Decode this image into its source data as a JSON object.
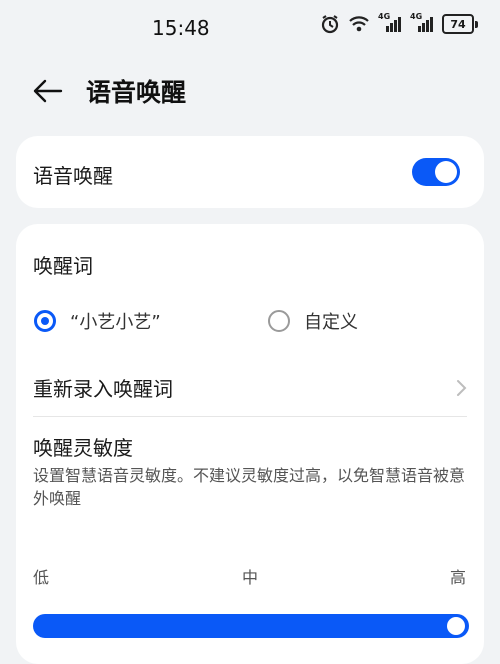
{
  "status_bar": {
    "time": "15:48",
    "signal1_label": "4G",
    "signal2_label": "4G",
    "battery": "74"
  },
  "header": {
    "title": "语音唤醒"
  },
  "voice_wakeup": {
    "label": "语音唤醒",
    "enabled": true
  },
  "wake_word": {
    "title": "唤醒词",
    "options": [
      {
        "label": "“小艺小艺”",
        "selected": true
      },
      {
        "label": "自定义",
        "selected": false
      }
    ],
    "rerecord_label": "重新录入唤醒词"
  },
  "sensitivity": {
    "title": "唤醒灵敏度",
    "description": "设置智慧语音灵敏度。不建议灵敏度过高，以免智慧语音被意外唤醒",
    "low": "低",
    "mid": "中",
    "high": "高",
    "level_fraction": 1.0
  },
  "colors": {
    "accent": "#0a59f7",
    "background": "#f1f3f5",
    "card": "#ffffff"
  }
}
